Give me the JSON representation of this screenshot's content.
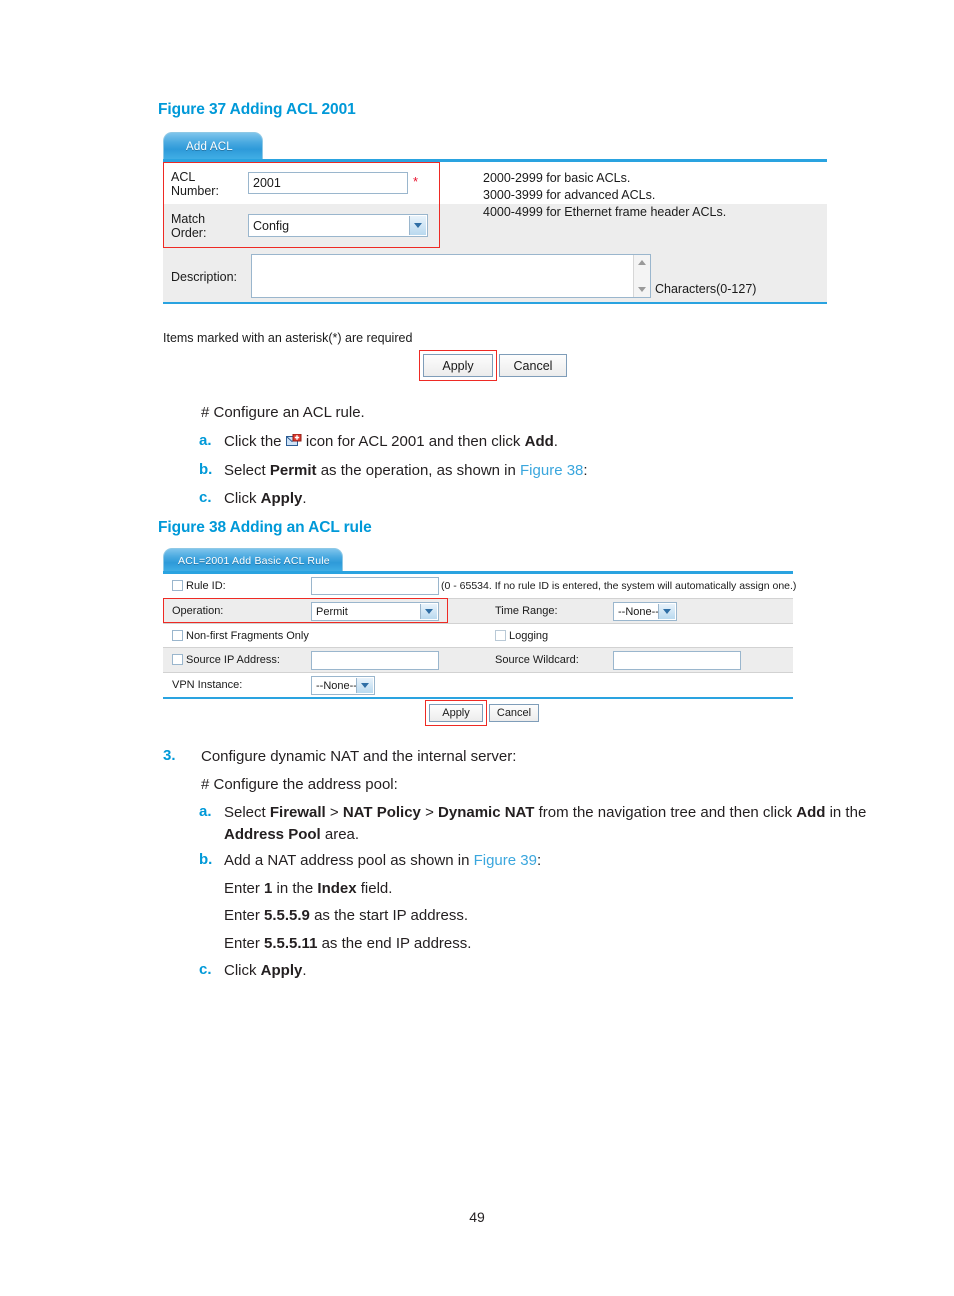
{
  "page": {
    "number": "49"
  },
  "figure37": {
    "caption": "Figure 37 Adding ACL 2001",
    "tab_label": "Add ACL",
    "fields": {
      "acl_number_label": "ACL\nNumber:",
      "acl_number_value": "2001",
      "acl_number_required_mark": "*",
      "match_order_label": "Match\nOrder:",
      "match_order_value": "Config",
      "description_label": "Description:",
      "description_value": "",
      "description_counter": "Characters(0-127)"
    },
    "help_text": "2000-2999 for basic ACLs.\n3000-3999 for advanced ACLs.\n4000-4999 for Ethernet frame header ACLs.",
    "required_note": "Items marked with an asterisk(*) are required",
    "buttons": {
      "apply": "Apply",
      "cancel": "Cancel"
    }
  },
  "between_text": {
    "heading": "# Configure an ACL rule.",
    "items": [
      {
        "marker": "a.",
        "segments": [
          {
            "t": "Click the ",
            "b": false
          },
          {
            "t": "__ICON__",
            "b": false
          },
          {
            "t": " icon for ACL 2001 and then click ",
            "b": false
          },
          {
            "t": "Add",
            "b": true
          },
          {
            "t": ".",
            "b": false
          }
        ]
      },
      {
        "marker": "b.",
        "segments": [
          {
            "t": "Select ",
            "b": false
          },
          {
            "t": "Permit",
            "b": true
          },
          {
            "t": " as the operation, as shown in ",
            "b": false
          },
          {
            "t": "Figure 38",
            "b": false,
            "link": true
          },
          {
            "t": ":",
            "b": false
          }
        ]
      },
      {
        "marker": "c.",
        "segments": [
          {
            "t": "Click ",
            "b": false
          },
          {
            "t": "Apply",
            "b": true
          },
          {
            "t": ".",
            "b": false
          }
        ]
      }
    ]
  },
  "figure38": {
    "caption": "Figure 38 Adding an ACL rule",
    "tab_label": "ACL=2001 Add Basic ACL Rule",
    "rows": {
      "rule_id_label": "Rule ID:",
      "rule_id_value": "",
      "rule_id_hint": "(0 - 65534. If no rule ID is entered, the system will automatically assign one.)",
      "operation_label": "Operation:",
      "operation_value": "Permit",
      "time_range_label": "Time Range:",
      "time_range_value": "--None--",
      "non_first_fragments_label": "Non-first Fragments Only",
      "logging_label": "Logging",
      "source_ip_label": "Source IP Address:",
      "source_ip_value": "",
      "source_wildcard_label": "Source Wildcard:",
      "source_wildcard_value": "",
      "vpn_instance_label": "VPN Instance:",
      "vpn_instance_value": "--None--"
    },
    "buttons": {
      "apply": "Apply",
      "cancel": "Cancel"
    }
  },
  "step3": {
    "marker": "3.",
    "title": "Configure dynamic NAT and the internal server:",
    "heading": "# Configure the address pool:",
    "items": [
      {
        "marker": "a.",
        "line1_segments": [
          {
            "t": "Select ",
            "b": false
          },
          {
            "t": "Firewall",
            "b": true
          },
          {
            "t": " > ",
            "b": false
          },
          {
            "t": "NAT Policy",
            "b": true
          },
          {
            "t": " > ",
            "b": false
          },
          {
            "t": "Dynamic NAT",
            "b": true
          },
          {
            "t": " from the navigation tree and then click ",
            "b": false
          },
          {
            "t": "Add",
            "b": true
          },
          {
            "t": " in the",
            "b": false
          }
        ],
        "line2_segments": [
          {
            "t": "Address Pool",
            "b": true
          },
          {
            "t": " area.",
            "b": false
          }
        ]
      },
      {
        "marker": "b.",
        "line1_segments": [
          {
            "t": "Add a NAT address pool as shown in ",
            "b": false
          },
          {
            "t": "Figure 39",
            "b": false,
            "link": true
          },
          {
            "t": ":",
            "b": false
          }
        ],
        "sublines": [
          [
            {
              "t": "Enter ",
              "b": false
            },
            {
              "t": "1",
              "b": true
            },
            {
              "t": " in the ",
              "b": false
            },
            {
              "t": "Index",
              "b": true
            },
            {
              "t": " field.",
              "b": false
            }
          ],
          [
            {
              "t": "Enter ",
              "b": false
            },
            {
              "t": "5.5.5.9",
              "b": true
            },
            {
              "t": " as the start IP address.",
              "b": false
            }
          ],
          [
            {
              "t": "Enter ",
              "b": false
            },
            {
              "t": "5.5.5.11",
              "b": true
            },
            {
              "t": " as the end IP address.",
              "b": false
            }
          ]
        ]
      },
      {
        "marker": "c.",
        "line1_segments": [
          {
            "t": "Click ",
            "b": false
          },
          {
            "t": "Apply",
            "b": true
          },
          {
            "t": ".",
            "b": false
          }
        ]
      }
    ]
  },
  "colors": {
    "caption_blue": "#0099d8",
    "tab_blue": "#2e9ad9",
    "highlight_red": "#ee2a24",
    "row_shade": "#ededed",
    "field_border": "#9ab6cd"
  }
}
